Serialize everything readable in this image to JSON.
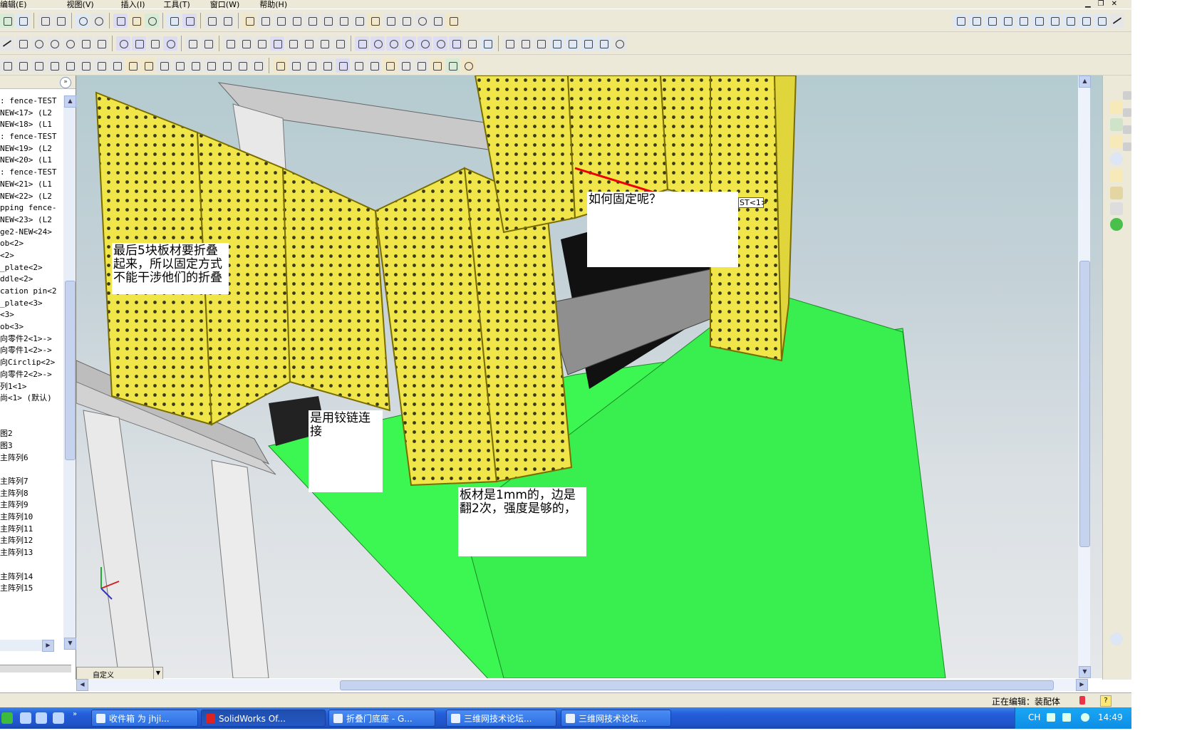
{
  "menubar": {
    "items": [
      "编辑(E)",
      "视图(V)",
      "插入(I)",
      "工具(T)",
      "窗口(W)",
      "帮助(H)"
    ]
  },
  "feature_tree": {
    "items": [
      ": fence-TEST",
      "NEW<17> (L2",
      "NEW<18> (L1",
      ": fence-TEST",
      "NEW<19> (L2",
      "NEW<20> (L1",
      ": fence-TEST",
      "NEW<21> (L1",
      "NEW<22> (L2",
      "pping fence-",
      "NEW<23> (L2",
      "ge2-NEW<24>",
      "ob<2>",
      "<2>",
      "_plate<2>",
      "ddle<2>",
      "cation pin<2",
      "_plate<3>",
      "<3>",
      "ob<3>",
      "向零件2<1>->",
      "向零件1<2>->",
      "向Circlip<2>",
      "向零件2<2>->",
      "列1<1>",
      "尚<1> (默认)",
      "",
      "",
      "图2",
      "图3",
      "主阵列6",
      "",
      "主阵列7",
      "主阵列8",
      "主阵列9",
      "主阵列10",
      "主阵列11",
      "主阵列12",
      "主阵列13",
      "",
      "主阵列14",
      "主阵列15"
    ]
  },
  "viewport": {
    "tab_label": "自定义",
    "part_tag": "ST<1>",
    "callouts": {
      "fold": "最后5块板材要折叠起来，所以固定方式不能干涉他们的折叠",
      "fix": "如何固定呢？",
      "hinge": "是用铰链连接",
      "sheet": "板材是1mm的，边是翻2次，强度是够的，"
    }
  },
  "statusbar": {
    "text": "正在编辑：装配体",
    "help": "?"
  },
  "taskbar": {
    "tasks": [
      "收件箱 为 jhji...",
      "SolidWorks Of...",
      "折叠门底座 - G...",
      "三维网技术论坛...",
      "三维网技术论坛..."
    ],
    "lang": "CH",
    "clock": "14:49"
  },
  "colors": {
    "panel_yellow": "#f0e64a",
    "base_green": "#3cf752",
    "sky_top": "#b4cbd0",
    "taskbar_blue": "#245edc"
  }
}
